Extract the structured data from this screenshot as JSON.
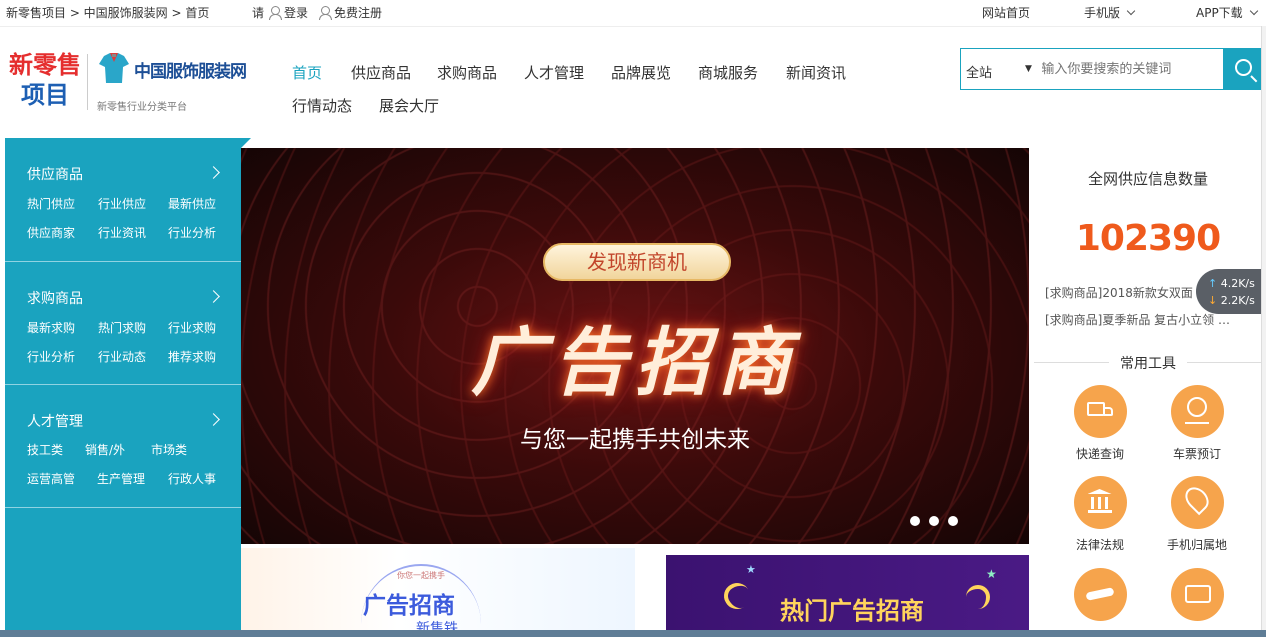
{
  "topbar": {
    "breadcrumb": "新零售项目 > 中国服饰服装网 > 首页",
    "ask": "请",
    "login": "登录",
    "register": "免费注册",
    "site_home": "网站首页",
    "mobile": "手机版",
    "app": "APP下载"
  },
  "logo": {
    "line1": "新零售",
    "line2": "项目",
    "brand": "中国服饰服装网",
    "slogan": "新零售行业分类平台"
  },
  "nav": [
    "首页",
    "供应商品",
    "求购商品",
    "人才管理",
    "品牌展览",
    "商城服务",
    "新闻资讯",
    "行情动态",
    "展会大厅"
  ],
  "search": {
    "scope": "全站",
    "placeholder": "输入你要搜索的关键词"
  },
  "sidebar": [
    {
      "title": "供应商品",
      "links": [
        "热门供应",
        "行业供应",
        "最新供应",
        "供应商家",
        "行业资讯",
        "行业分析"
      ]
    },
    {
      "title": "求购商品",
      "links": [
        "最新求购",
        "热门求购",
        "行业求购",
        "行业分析",
        "行业动态",
        "推荐求购"
      ]
    },
    {
      "title": "人才管理",
      "links": [
        "技工类",
        "销售/外",
        "市场类",
        "运营高管",
        "生产管理",
        "行政人事"
      ]
    }
  ],
  "banner": {
    "pill": "发现新商机",
    "title": "广告招商",
    "subtitle": "与您一起携手共创未来"
  },
  "ads": {
    "ad1_small": "你您一起携手",
    "ad1_title": "广告招商",
    "ad1_sub": "新售铁",
    "ad2_title": "热门广告招商"
  },
  "stats": {
    "title": "全网供应信息数量",
    "count": "102390"
  },
  "news": [
    "[求购商品]2018新款女双面",
    "[求购商品]夏季新品  复古小立领 …"
  ],
  "speed": {
    "up": "4.2",
    "down": "2.2",
    "unit": "K/s"
  },
  "tools": {
    "title": "常用工具",
    "items": [
      "快递查询",
      "车票预订",
      "法律法规",
      "手机归属地"
    ]
  },
  "colors": {
    "accent": "#1aa3bf",
    "number": "#ef5a1c",
    "tool": "#f6a44c"
  }
}
